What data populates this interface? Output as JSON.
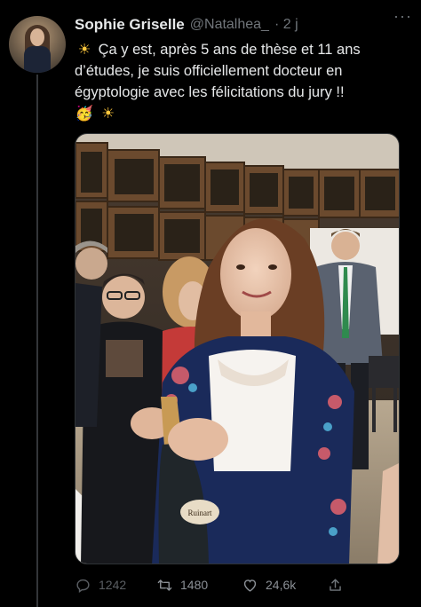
{
  "tweet": {
    "author_name": "Sophie Griselle",
    "author_handle": "@Natalhea_",
    "time": "· 2 j",
    "line1_rest": "Ça y est, après 5 ans de thèse et 11 ans",
    "line2": "d’études, je suis officiellement docteur en",
    "line3": "égyptologie avec les félicitations du jury !!",
    "emojis": [
      "sun",
      "face-with-party-horn",
      "sun"
    ],
    "more_glyph": "···"
  },
  "photo": {
    "bottle_label": "Ruinart"
  },
  "actions": {
    "reply_count": "1242",
    "retweet_count": "1480",
    "like_count": "24,6k"
  },
  "colors": {
    "background": "#000000",
    "text": "#e7e9ea",
    "secondary": "#71767b",
    "sun": "#ffc83d"
  }
}
